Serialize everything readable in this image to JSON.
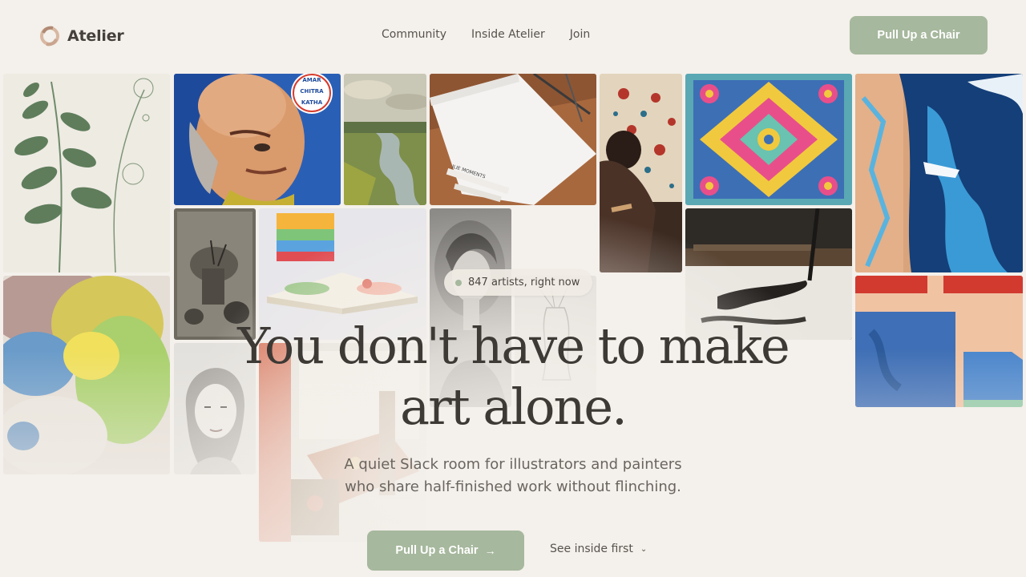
{
  "brand": {
    "name": "Atelier",
    "accent": "#a6b89d",
    "background": "#f4f0eb"
  },
  "nav": {
    "items": [
      "Community",
      "Inside Atelier",
      "Join"
    ]
  },
  "header": {
    "cta_label": "Pull Up a Chair"
  },
  "hero": {
    "badge": "847 artists, right now",
    "title_line1": "You don't have to make",
    "title_line2": "art alone.",
    "subtitle_line1": "A quiet Slack room for illustrators and painters",
    "subtitle_line2": "who share half-finished work without flinching.",
    "primary_cta": "Pull Up a Chair",
    "secondary_cta": "See inside first"
  },
  "icons": {
    "logo": "atelier-logo-icon",
    "arrow": "arrow-right-icon",
    "chevron": "chevron-down-icon"
  },
  "artworks": {
    "comic_seal": [
      "AMAR",
      "CHITRA",
      "KATHA"
    ],
    "marker_label": "JLIE MOMENTS"
  }
}
